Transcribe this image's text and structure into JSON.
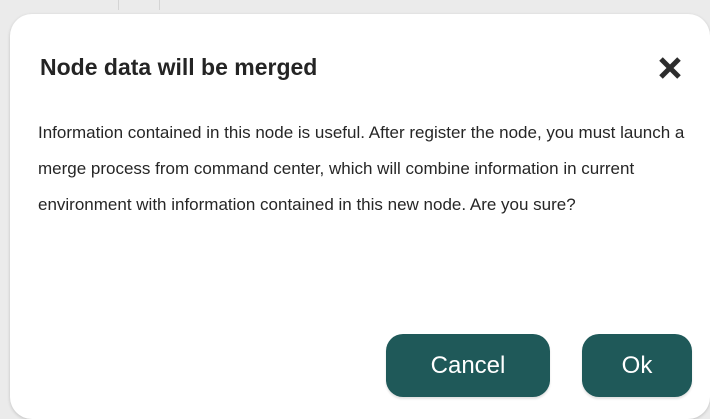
{
  "dialog": {
    "title": "Node data will be merged",
    "message": "Information contained in this node is useful. After register the node, you must launch a merge process from command center, which will combine information in current environment with information contained in this new node. Are you sure?",
    "close_icon": "close-x-icon",
    "buttons": {
      "cancel": "Cancel",
      "ok": "Ok"
    }
  },
  "colors": {
    "button_accent": "#1f5959",
    "title_text": "#242424",
    "body_text": "#262626",
    "dialog_background": "#ffffff"
  }
}
